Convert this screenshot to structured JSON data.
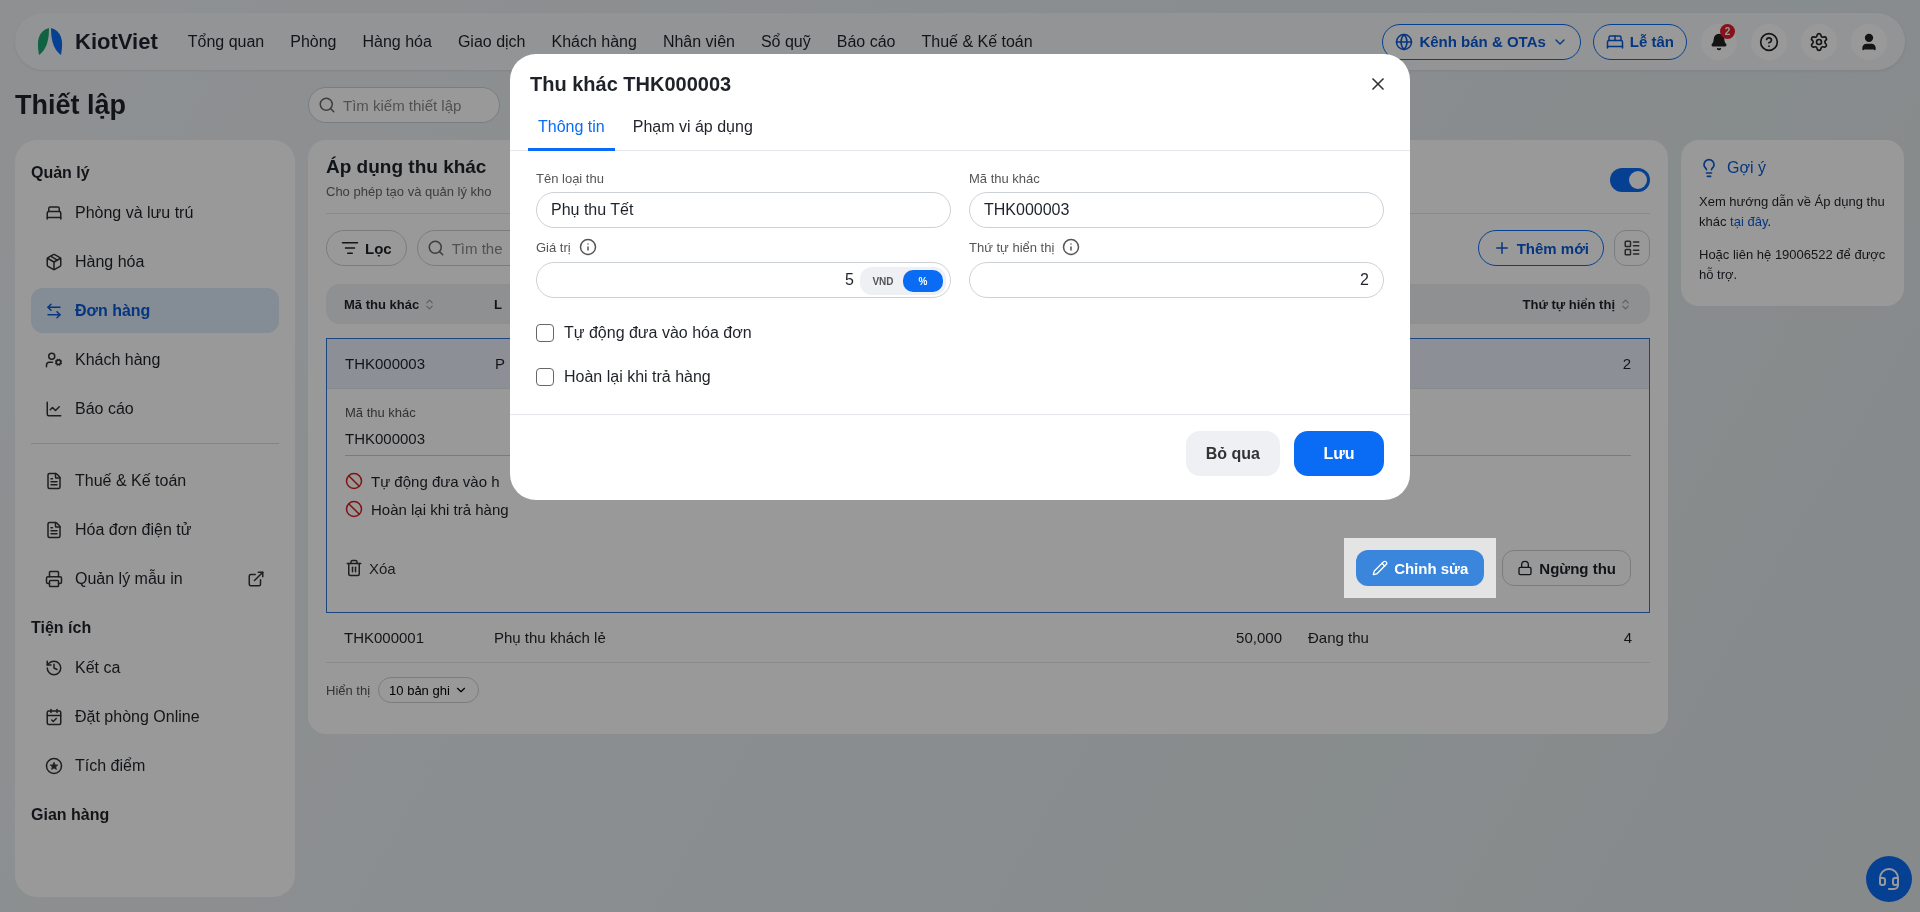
{
  "nav": {
    "brand": "KiotViet",
    "items": [
      "Tổng quan",
      "Phòng",
      "Hàng hóa",
      "Giao dịch",
      "Khách hàng",
      "Nhân viên",
      "Sổ quỹ",
      "Báo cáo",
      "Thuế & Kế toán"
    ],
    "channel_button": "Kênh bán & OTAs",
    "reception_button": "Lễ tân",
    "notification_count": "2"
  },
  "page_title": "Thiết lập",
  "search": {
    "placeholder": "Tìm kiếm thiết lập"
  },
  "sidebar": {
    "sections": [
      {
        "title": "Quản lý",
        "groups": [
          [
            {
              "label": "Phòng và lưu trú",
              "selected": false,
              "external": false
            },
            {
              "label": "Hàng hóa",
              "selected": false,
              "external": false
            },
            {
              "label": "Đơn hàng",
              "selected": true,
              "external": false
            },
            {
              "label": "Khách hàng",
              "selected": false,
              "external": false
            },
            {
              "label": "Báo cáo",
              "selected": false,
              "external": false
            }
          ],
          [
            {
              "label": "Thuế & Kế toán",
              "selected": false,
              "external": false
            },
            {
              "label": "Hóa đơn điện tử",
              "selected": false,
              "external": false
            },
            {
              "label": "Quản lý mẫu in",
              "selected": false,
              "external": true
            }
          ]
        ]
      },
      {
        "title": "Tiện ích",
        "groups": [
          [
            {
              "label": "Kết ca",
              "selected": false,
              "external": false
            },
            {
              "label": "Đặt phòng Online",
              "selected": false,
              "external": false
            },
            {
              "label": "Tích điểm",
              "selected": false,
              "external": false
            }
          ]
        ]
      },
      {
        "title": "Gian hàng"
      }
    ]
  },
  "main": {
    "title": "Áp dụng thu khác",
    "subtitle": "Cho phép tạo và quản lý kho",
    "enabled": true,
    "filter_button": "Lọc",
    "search_placeholder": "Tìm the",
    "add_button": "Thêm mới",
    "columns": [
      "Mã thu khác",
      "L"
    ],
    "last_column": "Thứ tự hiển thị",
    "rows": [
      {
        "code": "THK000003",
        "name": "P",
        "order": "2",
        "expanded": true
      },
      {
        "code": "THK000001",
        "name": "Phụ thu khách lẻ",
        "value": "50,000",
        "status": "Đang thu",
        "order": "4",
        "expanded": false
      }
    ],
    "detail": {
      "label": "Mã thu khác",
      "value": "THK000003",
      "flags": [
        "Tự động đưa vào h",
        "Hoàn lại khi trả hàng"
      ],
      "delete_button": "Xóa",
      "edit_button": "Chỉnh sửa",
      "stop_button": "Ngừng thu"
    },
    "footer": {
      "label": "Hiển thị",
      "page_size": "10 bản ghi"
    }
  },
  "tips": {
    "title": "Gợi ý",
    "before": "Xem hướng dẫn về Áp dụng thu khác ",
    "link": "tại đây",
    "after": ".",
    "contact": "Hoặc liên hệ 19006522 để được hỗ trợ."
  },
  "modal": {
    "title": "Thu khác THK000003",
    "tabs": [
      {
        "label": "Thông tin",
        "selected": true
      },
      {
        "label": "Phạm vi áp dụng",
        "selected": false
      }
    ],
    "name_label": "Tên loại thu",
    "name_value": "Phụ thu Tết",
    "code_label": "Mã thu khác",
    "code_value": "THK000003",
    "value_label": "Giá trị",
    "value": "5",
    "units": [
      {
        "label": "VND",
        "selected": false
      },
      {
        "label": "%",
        "selected": true
      }
    ],
    "order_label": "Thứ tự hiển thị",
    "order_value": "2",
    "checkboxes": [
      {
        "label": "Tự động đưa vào hóa đơn",
        "checked": false
      },
      {
        "label": "Hoàn lại khi trả hàng",
        "checked": false
      }
    ],
    "cancel_button": "Bỏ qua",
    "save_button": "Lưu"
  }
}
